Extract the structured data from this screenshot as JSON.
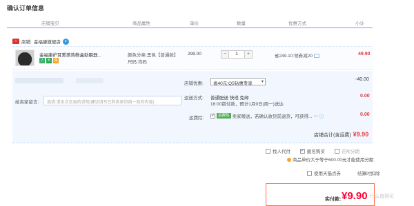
{
  "page": {
    "title": "确认订单信息"
  },
  "table_headers": [
    "店铺宝贝",
    "商品属性",
    "单价",
    "数量",
    "优惠方式",
    "小计"
  ],
  "shop": {
    "label": "店铺:",
    "name": "金福康旗舰店",
    "icon": "shop-logo-icon",
    "chat_icon": "wangwang-icon"
  },
  "item": {
    "title": "金福康护耳熏蒸热敷盒助眠器...",
    "badges": [
      "7",
      "天",
      "保"
    ],
    "color_label": "颜色分类:",
    "color_value": "黑色【普通款】",
    "size_label": "尺码:",
    "size_value": "均码",
    "price": "299.00",
    "quantity": "1",
    "qty_minus": "−",
    "qty_plus": "+",
    "promo": "省249.10:领券减20",
    "subtotal": "49.90"
  },
  "options": {
    "memo_label": "给卖家留言:",
    "memo_placeholder": "选填:请本次交易的说明(建议填写已和卖家协商一致的内容)",
    "coupon_label": "店铺优惠:",
    "coupon_value": "省40元:Q5钻惠专享",
    "coupon_discount": "-40.00",
    "shipping_label": "运送方式:",
    "shipping_line1": "普通配送 快递 免邮",
    "shipping_line2": "16:00前付款，预计1月9日(周一)送达",
    "shipping_fee": "0.00",
    "insurance_label": "运费险:",
    "insurance_tag": "运费险",
    "insurance_text": "卖家赠送，若确认收货前退货，可获得...",
    "insurance_fee": "0.00",
    "shop_total_label": "店铺合计(含运费)",
    "shop_total_value": "¥9.90"
  },
  "checkout": {
    "anonymous_label": "匿名购买",
    "proxy_label": "找人代付",
    "installment_label": "花呗分期",
    "free_ship_note": "商品单价大于等于600.00元才能使用分期",
    "tmall_points_label": "使用天猫点券",
    "finance_label": "结算时扣除",
    "pay_label": "实付款:",
    "pay_value": "¥9.90"
  },
  "watermark": "什么值得买"
}
